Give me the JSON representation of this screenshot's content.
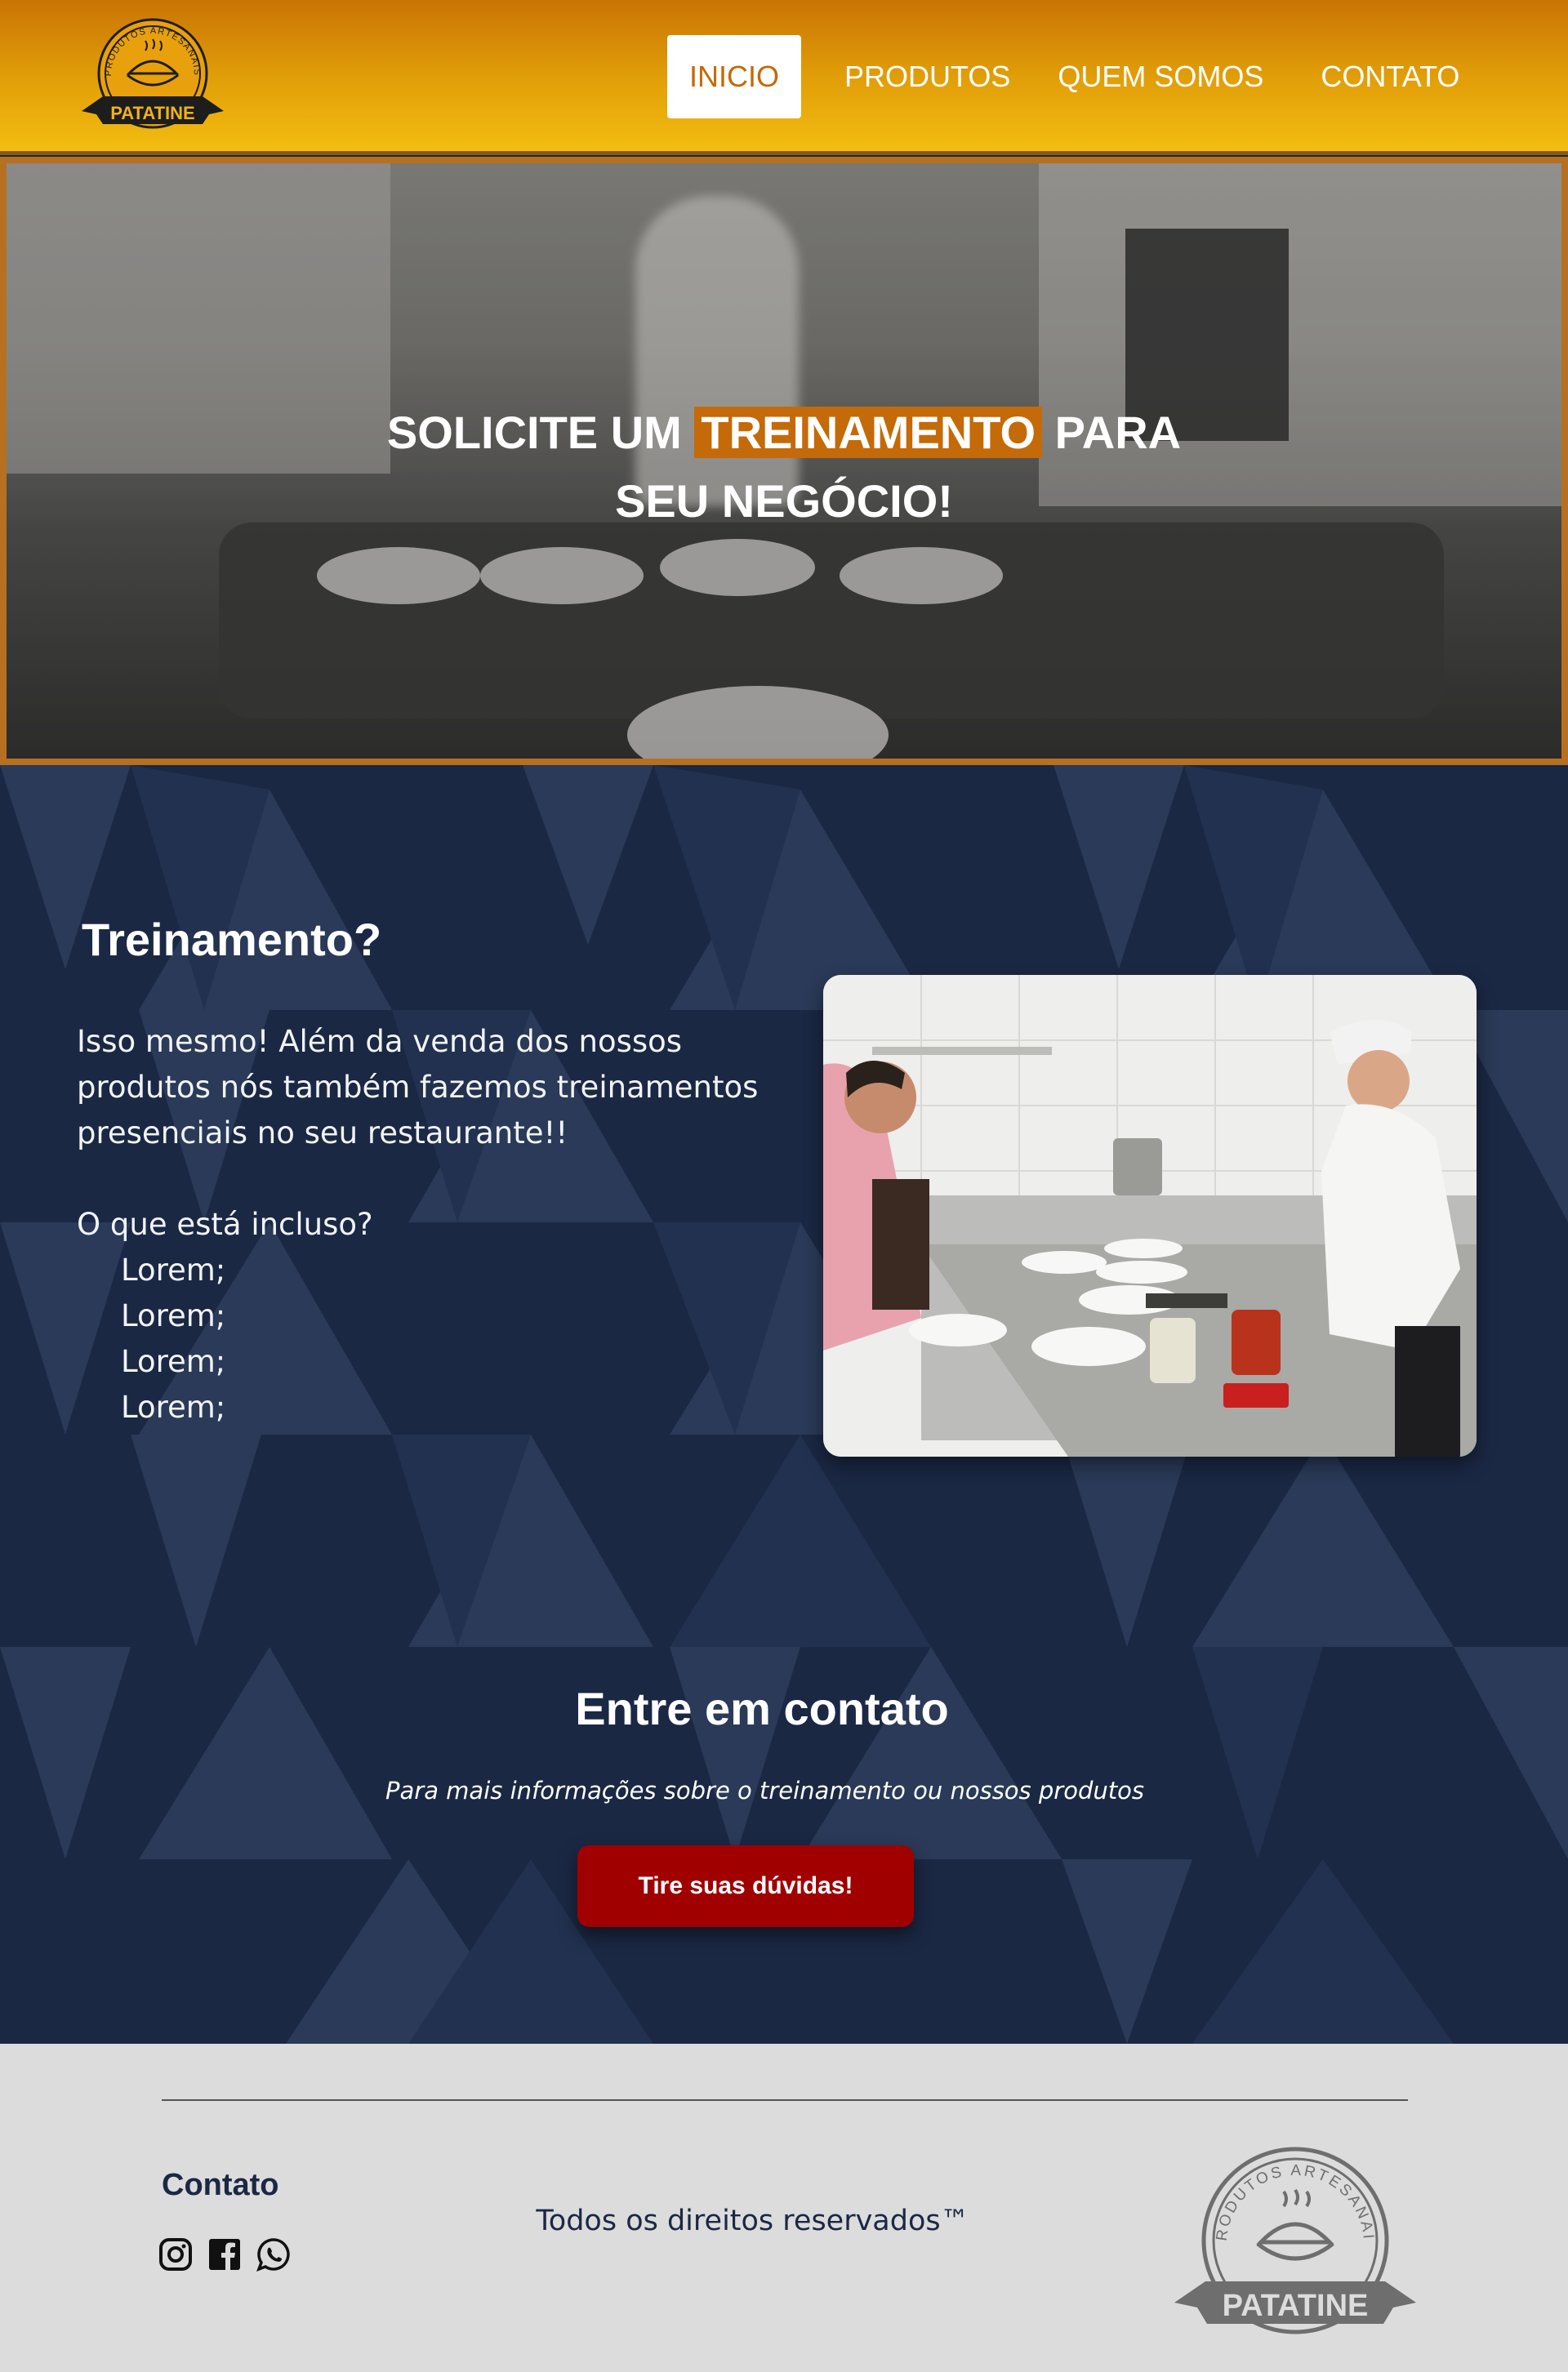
{
  "brand": {
    "top_text": "PRODUTOS ARTESANAIS",
    "name": "PATATINE"
  },
  "nav": {
    "items": [
      {
        "label": "INICIO",
        "active": true
      },
      {
        "label": "PRODUTOS",
        "active": false
      },
      {
        "label": "QUEM SOMOS",
        "active": false
      },
      {
        "label": "CONTATO",
        "active": false
      }
    ]
  },
  "hero": {
    "line1_before": "SOLICITE UM",
    "highlight": "TREINAMENTO",
    "line1_after": "PARA",
    "line2": "SEU NEGÓCIO!"
  },
  "training": {
    "title": "Treinamento?",
    "paragraph": "Isso mesmo! Além da venda dos nossos produtos nós também fazemos treinamentos presenciais no seu restaurante!!",
    "included_label": "O que está incluso?",
    "items": [
      "Lorem;",
      "Lorem;",
      "Lorem;",
      "Lorem;"
    ]
  },
  "contact": {
    "title": "Entre em contato",
    "subtitle": "Para mais informações sobre o treinamento ou nossos produtos",
    "button": "Tire suas dúvidas!"
  },
  "footer": {
    "contact_label": "Contato",
    "rights": "Todos os direitos reservados™",
    "socials": [
      "instagram-icon",
      "facebook-icon",
      "whatsapp-icon"
    ]
  },
  "colors": {
    "header_gradient_top": "#c97405",
    "header_gradient_bottom": "#f3bd10",
    "accent": "#c46a08",
    "navy": "#1b2844",
    "cta": "#a10000",
    "footer_bg": "#dcdcdc"
  }
}
